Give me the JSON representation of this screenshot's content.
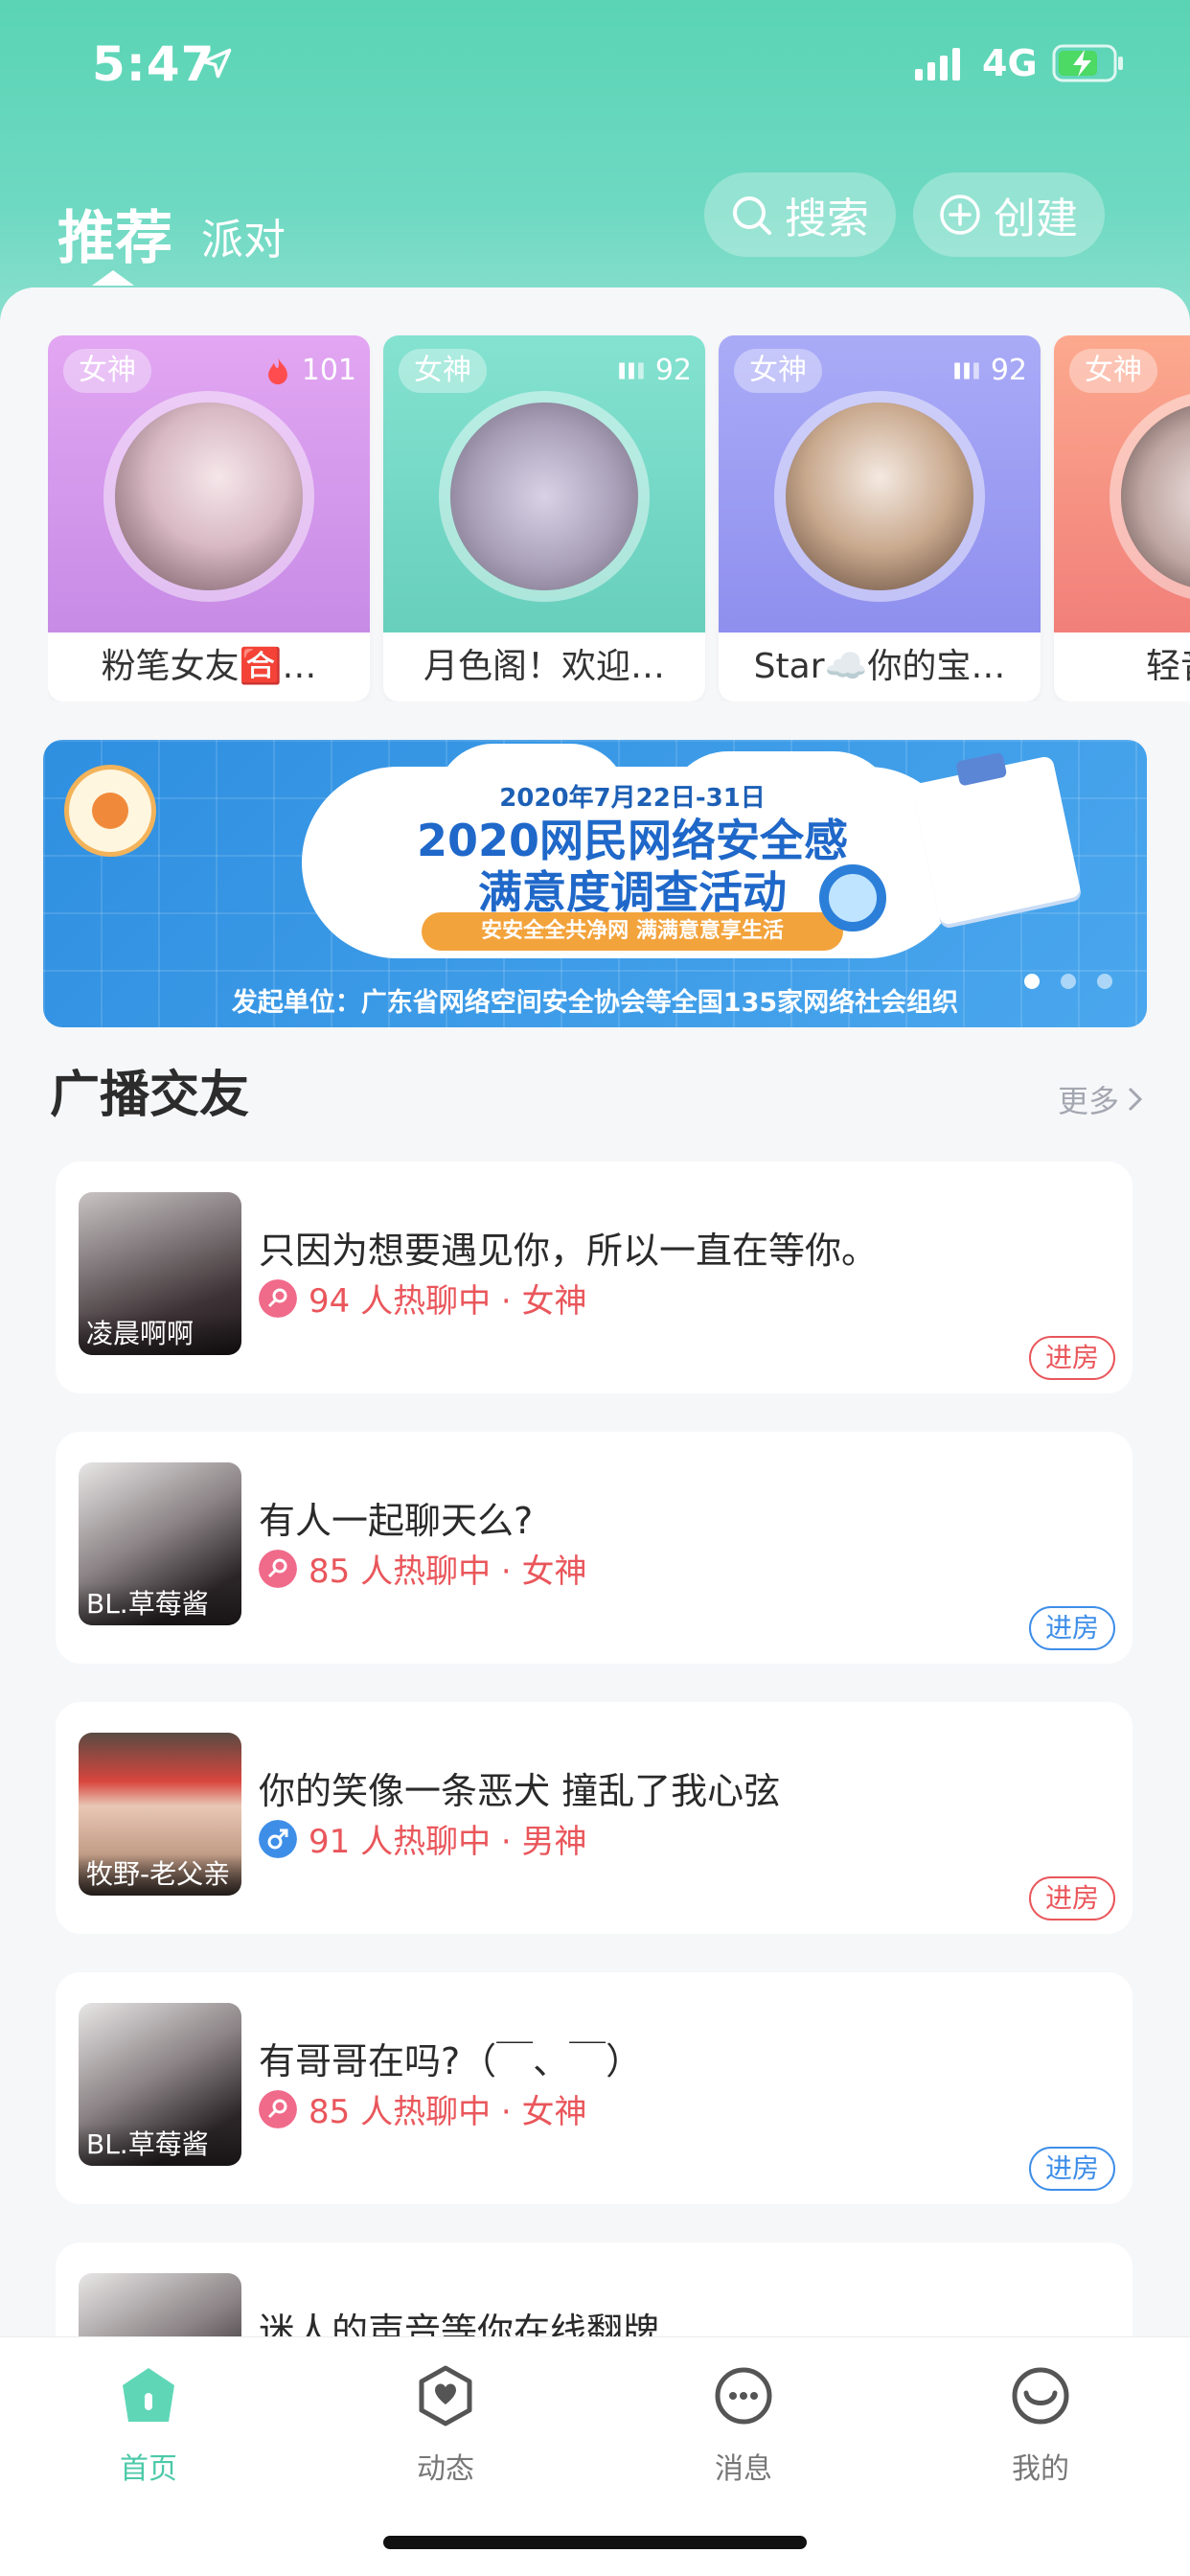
{
  "status_bar": {
    "time": "5:47",
    "network": "4G"
  },
  "header": {
    "tabs": [
      {
        "label": "推荐",
        "active": true
      },
      {
        "label": "派对",
        "active": false
      }
    ],
    "search_label": "搜索",
    "create_label": "创建"
  },
  "rooms": [
    {
      "tag": "女神",
      "heat_icon": "flame-icon",
      "heat": "101",
      "title": "粉笔女友🈴…",
      "color_top": "#e0a3f0",
      "color_bottom": "#c98ee8"
    },
    {
      "tag": "女神",
      "heat_icon": "bars-icon",
      "heat": "92",
      "title": "月色阁！欢迎…",
      "color_top": "#7fe0cd",
      "color_bottom": "#69cfbd"
    },
    {
      "tag": "女神",
      "heat_icon": "bars-icon",
      "heat": "92",
      "title": "Star☁️你的宝…",
      "color_top": "#a7a8f6",
      "color_bottom": "#8f90ef"
    },
    {
      "tag": "女神",
      "heat_icon": "bars-icon",
      "heat": "",
      "title": "轻音少…",
      "color_top": "#fba58c",
      "color_bottom": "#f2827c"
    }
  ],
  "banner": {
    "date": "2020年7月22日-31日",
    "headline_1": "2020网民网络安全感",
    "headline_2": "满意度调查活动",
    "slogan": "安安全全共净网  满满意意享生活",
    "footer": "发起单位：广东省网络空间安全协会等全国135家网络社会组织"
  },
  "section": {
    "title": "广播交友",
    "more": "更多"
  },
  "broadcasts": [
    {
      "name": "凌晨啊啊",
      "title": "只因为想要遇见你，所以一直在等你。",
      "gender": "female",
      "meta": "94 人热聊中 · 女神",
      "enter": "进房",
      "enter_style": "red"
    },
    {
      "name": "BL.草莓酱",
      "title": "有人一起聊天么?",
      "gender": "female",
      "meta": "85 人热聊中 · 女神",
      "enter": "进房",
      "enter_style": "blue"
    },
    {
      "name": "牧野-老父亲",
      "title": "你的笑像一条恶犬 撞乱了我心弦",
      "gender": "male",
      "meta": "91 人热聊中 · 男神",
      "enter": "进房",
      "enter_style": "red"
    },
    {
      "name": "BL.草莓酱",
      "title": "有哥哥在吗?（￣、￣）",
      "gender": "female",
      "meta": "85 人热聊中 · 女神",
      "enter": "进房",
      "enter_style": "blue"
    },
    {
      "name": "",
      "title": "迷人的声音等你在线翻牌",
      "gender": "female",
      "meta": "",
      "enter": "",
      "enter_style": "red"
    }
  ],
  "tabbar": [
    {
      "label": "首页",
      "icon": "home-icon",
      "active": true
    },
    {
      "label": "动态",
      "icon": "feed-icon",
      "active": false
    },
    {
      "label": "消息",
      "icon": "message-icon",
      "active": false
    },
    {
      "label": "我的",
      "icon": "profile-icon",
      "active": false
    }
  ],
  "colors": {
    "brand": "#5ad4b4",
    "accent_red": "#e9565b",
    "accent_blue": "#3e8ee8",
    "female": "#f06a8a",
    "male": "#3e8ee8"
  }
}
